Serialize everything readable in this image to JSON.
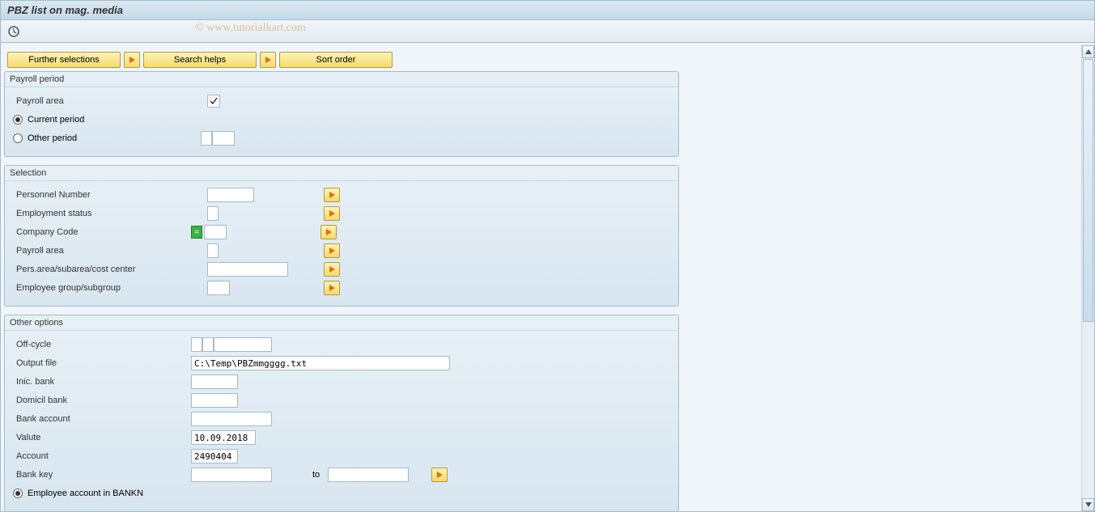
{
  "title": "PBZ list on mag. media",
  "watermark": "© www.tutorialkart.com",
  "buttons": {
    "further": "Further selections",
    "search": "Search helps",
    "sort": "Sort order"
  },
  "payroll_period": {
    "title": "Payroll period",
    "area_label": "Payroll area",
    "area_value": "",
    "current_label": "Current period",
    "current_checked": true,
    "other_label": "Other period",
    "other_checked": false,
    "other_v1": "",
    "other_v2": ""
  },
  "selection": {
    "title": "Selection",
    "rows": [
      {
        "label": "Personnel Number",
        "value": "",
        "width": "sm",
        "multi": true
      },
      {
        "label": "Employment status",
        "value": "",
        "width": "tiny",
        "multi": true
      },
      {
        "label": "Company Code",
        "value": "",
        "width": "xs",
        "multi": true,
        "eq": true
      },
      {
        "label": "Payroll area",
        "value": "",
        "width": "tiny",
        "multi": true
      },
      {
        "label": "Pers.area/subarea/cost center",
        "value": "",
        "width": "md",
        "multi": true
      },
      {
        "label": "Employee group/subgroup",
        "value": "",
        "width": "xs",
        "multi": true
      }
    ]
  },
  "other": {
    "title": "Other options",
    "offcycle_label": "Off-cycle",
    "offcycle_v1": "",
    "offcycle_v2": "",
    "offcycle_v3": "",
    "output_label": "Output file",
    "output_value": "C:\\Temp\\PBZmmgggg.txt",
    "inic_label": "Inic. bank",
    "inic_value": "",
    "dom_label": "Domicil bank",
    "dom_value": "",
    "acct_label": "Bank account",
    "acct_value": "",
    "valute_label": "Valute",
    "valute_value": "10.09.2018",
    "account_label": "Account",
    "account_value": "2490404",
    "bankkey_label": "Bank key",
    "bankkey_from": "",
    "to_label": "to",
    "bankkey_to": "",
    "emp_radio_label": "Employee account in BANKN",
    "emp_radio_checked": true
  }
}
